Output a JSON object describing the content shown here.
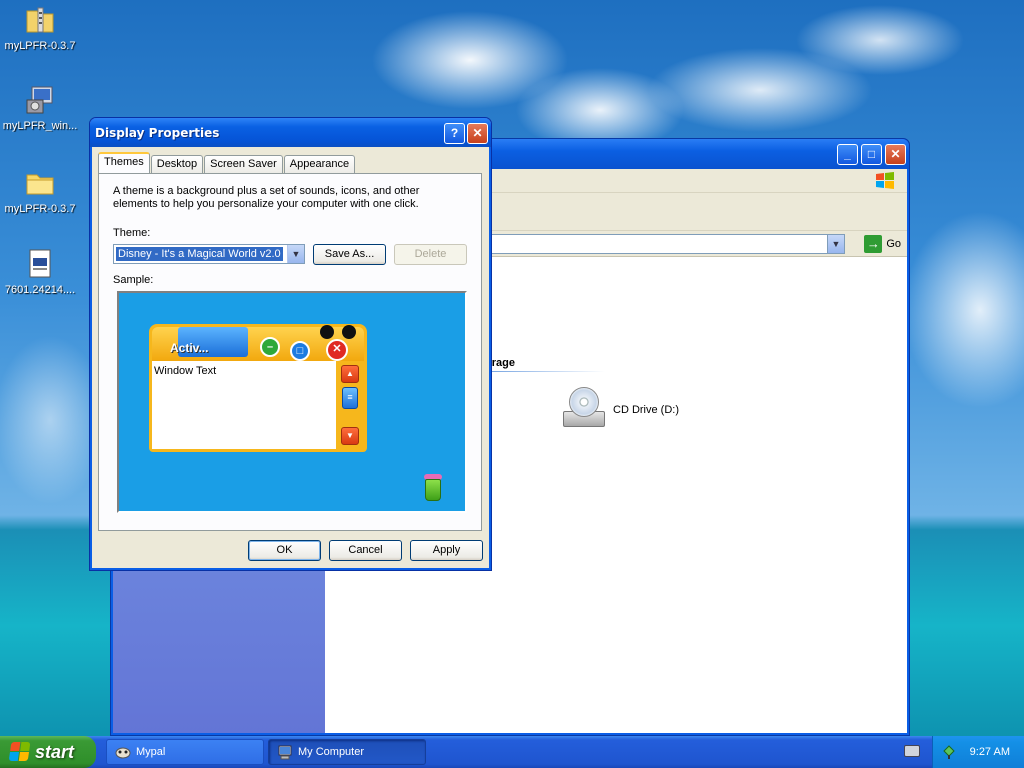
{
  "desktop": {
    "icons": [
      {
        "label": "myLPFR-0.3.7",
        "icon": "zip-folder-icon"
      },
      {
        "label": "myLPFR_win...",
        "icon": "installer-icon"
      },
      {
        "label": "myLPFR-0.3.7",
        "icon": "folder-icon"
      },
      {
        "label": "7601.24214....",
        "icon": "document-icon"
      }
    ]
  },
  "my_computer": {
    "address_go": "Go",
    "group_heading": "orage",
    "drive_label": "CD Drive (D:)"
  },
  "dialog": {
    "title": "Display Properties",
    "help_label": "?",
    "close_label": "✕",
    "tabs": [
      "Themes",
      "Desktop",
      "Screen Saver",
      "Appearance"
    ],
    "description": "A theme is a background plus a set of sounds, icons, and other elements to help you personalize your computer with one click.",
    "theme_label": "Theme:",
    "theme_value": "Disney - It's a Magical World v2.0",
    "save_as": "Save As...",
    "delete": "Delete",
    "sample_label": "Sample:",
    "sample_title": "Activ...",
    "sample_text": "Window Text",
    "ok": "OK",
    "cancel": "Cancel",
    "apply": "Apply"
  },
  "taskbar": {
    "start": "start",
    "tasks": [
      {
        "label": "Mypal",
        "icon": "mypal-icon"
      },
      {
        "label": "My Computer",
        "icon": "my-computer-icon"
      }
    ],
    "clock": "9:27 AM"
  },
  "colors": {
    "xp_blue": "#0a5ee6",
    "dialog_face": "#ece9d8",
    "start_green": "#3a9a35",
    "selection": "#316ac5",
    "sample_bg": "#1a9ee6",
    "sample_frame": "#f6b71c"
  }
}
